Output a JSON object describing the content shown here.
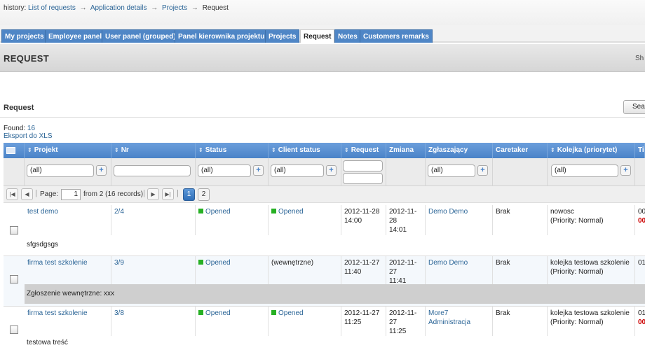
{
  "history": {
    "label": "history:",
    "links": [
      "List of requests",
      "Application details",
      "Projects"
    ],
    "current": "Request",
    "separator": "→"
  },
  "tabs": [
    {
      "label": "My projects",
      "active": false
    },
    {
      "label": "Employee panel",
      "active": false
    },
    {
      "label": "User panel (grouped)",
      "active": false
    },
    {
      "label": "Panel kierownika projektu",
      "active": false
    },
    {
      "label": "Projects",
      "active": false
    },
    {
      "label": "Request",
      "active": true
    },
    {
      "label": "Notes",
      "active": false
    },
    {
      "label": "Customers remarks",
      "active": false
    }
  ],
  "page_title": "REQUEST",
  "top_right_cut": "Sh",
  "section_title": "Request",
  "search_label": "Sear",
  "found_label": "Found:",
  "found_count": "16",
  "export_label": "Eksport do XLS",
  "columns": [
    "Projekt",
    "Nr",
    "Status",
    "Client status",
    "Request",
    "Zmiana",
    "Zgłaszający",
    "Caretaker",
    "Kolejka (priorytet)",
    "Ti"
  ],
  "filters": {
    "projekt": "(all)",
    "status": "(all)",
    "client_status": "(all)",
    "zglaszajacy": "(all)",
    "kolejka": "(all)",
    "plus": "+"
  },
  "pager": {
    "page_label": "Page:",
    "page_value": "1",
    "from_text": "from 2 (16 records)",
    "pages": [
      "1",
      "2"
    ]
  },
  "rows": [
    {
      "projekt": "test demo",
      "nr": "2/4",
      "status": "Opened",
      "client_status": "Opened",
      "request": [
        "2012-11-28",
        "14:00"
      ],
      "zmiana": [
        "2012-11-28",
        "14:01"
      ],
      "zglaszajacy": "Demo Demo",
      "caretaker": "Brak",
      "kolejka": [
        "nowosc",
        "(Priority: Normal)"
      ],
      "ti": [
        "00",
        "00"
      ],
      "desc": "sfgsdgsgs"
    },
    {
      "projekt": "firma test szkolenie",
      "nr": "3/9",
      "status": "Opened",
      "client_status": "(wewnętrzne)",
      "request": [
        "2012-11-27",
        "11:40"
      ],
      "zmiana": [
        "2012-11-27",
        "11:41"
      ],
      "zglaszajacy": "Demo Demo",
      "caretaker": "Brak",
      "kolejka": [
        "kolejka testowa szkolenie",
        "(Priority: Normal)"
      ],
      "ti": [
        "01",
        ""
      ],
      "desc": "Zgłoszenie wewnętrzne: xxx"
    },
    {
      "projekt": "firma test szkolenie",
      "nr": "3/8",
      "status": "Opened",
      "client_status": "Opened",
      "request": [
        "2012-11-27",
        "11:25"
      ],
      "zmiana": [
        "2012-11-27",
        "11:25"
      ],
      "zglaszajacy": "More7 Administracja",
      "caretaker": "Brak",
      "kolejka": [
        "kolejka testowa szkolenie",
        "(Priority: Normal)"
      ],
      "ti": [
        "01",
        "00"
      ],
      "desc": "testowa treść"
    }
  ],
  "colors": {
    "accent": "#4a83c8",
    "status_green": "#27b024",
    "internal_row": "#cfcfcf"
  }
}
